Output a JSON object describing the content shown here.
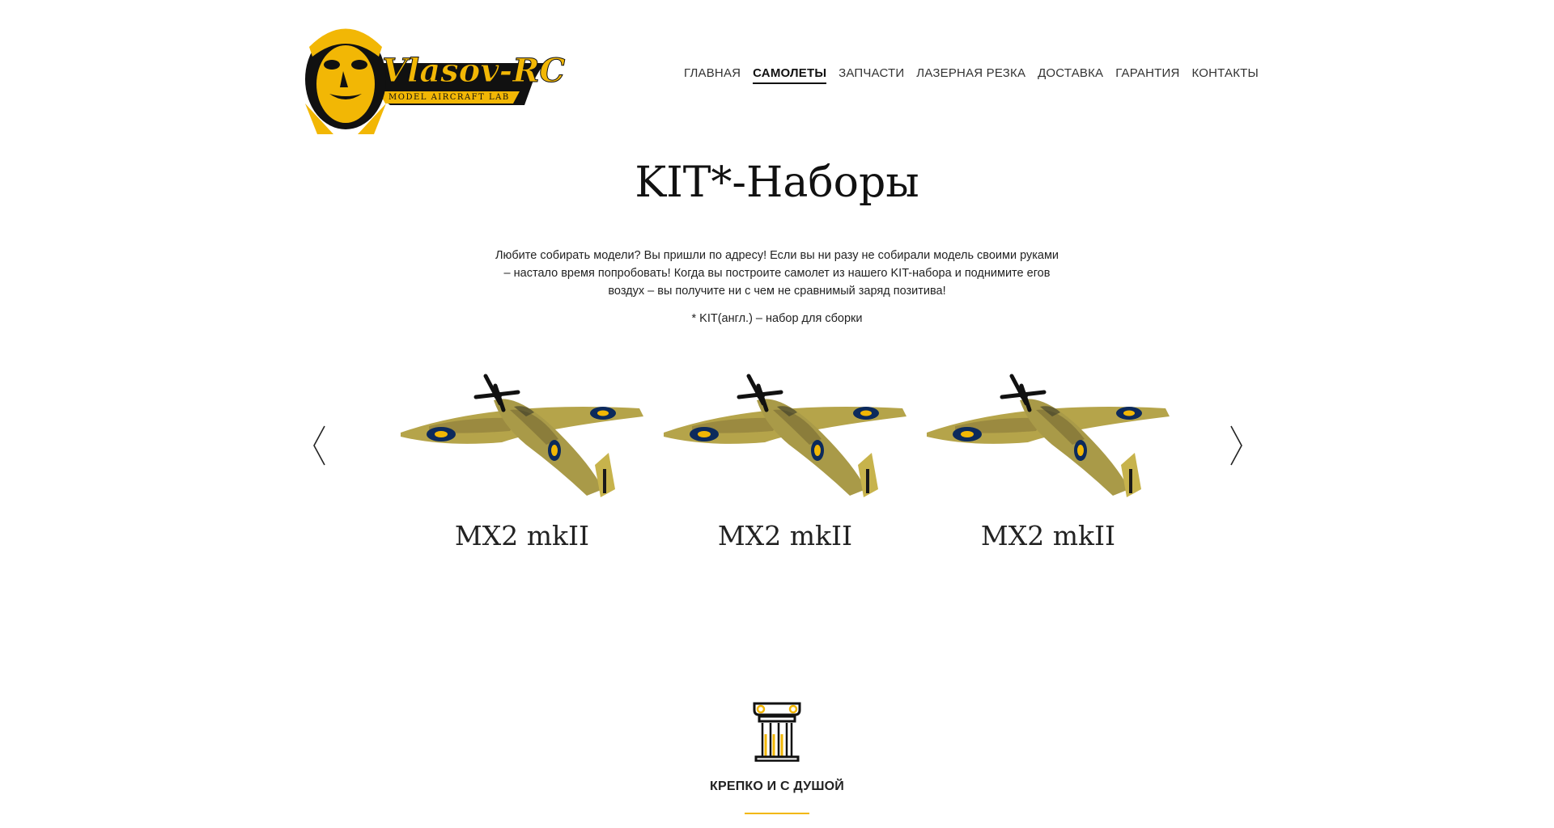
{
  "header": {
    "logo": {
      "brand_text": "Vlasov-RC",
      "tagline": "MODEL AIRCRAFT LAB",
      "accent_color": "#f2b705",
      "icon": "aviator-pilot-logo"
    },
    "nav": [
      {
        "label": "ГЛАВНАЯ",
        "active": false
      },
      {
        "label": "САМОЛЕТЫ",
        "active": true
      },
      {
        "label": "ЗАПЧАСТИ",
        "active": false
      },
      {
        "label": "ЛАЗЕРНАЯ РЕЗКА",
        "active": false
      },
      {
        "label": "ДОСТАВКА",
        "active": false
      },
      {
        "label": "ГАРАНТИЯ",
        "active": false
      },
      {
        "label": "КОНТАКТЫ",
        "active": false
      }
    ]
  },
  "kits": {
    "title": "KIT*-Наборы",
    "intro": "Любите собирать модели? Вы пришли по адресу! Если вы ни разу не собирали модель своими руками – настало время попробовать! Когда вы построите самолет из нашего KIT-набора и поднимите егов воздух – вы получите ни с чем не сравнимый заряд позитива!",
    "footnote": "* KIT(англ.) – набор для сборки",
    "carousel": {
      "prev_icon": "chevron-left-icon",
      "next_icon": "chevron-right-icon",
      "slides": [
        {
          "name": "MX2 mkII",
          "image": "spitfire-plane-image"
        },
        {
          "name": "MX2 mkII",
          "image": "spitfire-plane-image"
        },
        {
          "name": "MX2 mkII",
          "image": "spitfire-plane-image"
        }
      ]
    }
  },
  "feature": {
    "icon": "column-icon",
    "title": "КРЕПКО И С ДУШОЙ",
    "accent_color": "#f2b705"
  }
}
